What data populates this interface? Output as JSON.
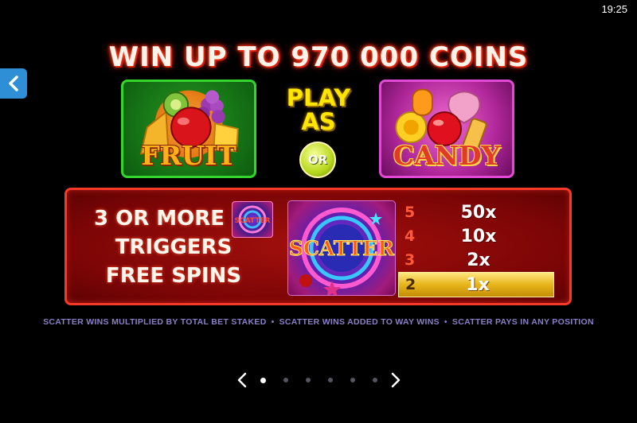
{
  "status_bar": {
    "time": "19:25"
  },
  "headline": "WIN UP TO 970 000 COINS",
  "themes": {
    "left_label": "FRUIT",
    "right_label": "CANDY",
    "play_as_line1": "PLAY",
    "play_as_line2": "AS",
    "or_label": "OR"
  },
  "scatter": {
    "trigger_line1": "3 OR MORE",
    "trigger_line2": "TRIGGERS",
    "trigger_line3": "FREE SPINS",
    "mini_symbol_label": "SCATTER",
    "symbol_label": "SCATTER",
    "paytable": [
      {
        "count": "5",
        "payout": "50x",
        "highlighted": false
      },
      {
        "count": "4",
        "payout": "10x",
        "highlighted": false
      },
      {
        "count": "3",
        "payout": "2x",
        "highlighted": false
      },
      {
        "count": "2",
        "payout": "1x",
        "highlighted": true
      }
    ]
  },
  "footnotes": [
    "SCATTER WINS MULTIPLIED BY TOTAL BET STAKED",
    "SCATTER WINS ADDED TO WAY WINS",
    "SCATTER PAYS IN ANY POSITION"
  ],
  "pager": {
    "page_count": 6,
    "current_page": 1
  },
  "icons": {
    "back": "chevron-left-icon",
    "prev": "chevron-left-icon",
    "next": "chevron-right-icon"
  },
  "colors": {
    "panel_border": "#f53a2a",
    "fruit_border": "#34d52c",
    "candy_border": "#e24ad6",
    "play_as": "#ffe600",
    "highlight_row": "#e7b51c",
    "footnote": "#8b7fc6"
  }
}
